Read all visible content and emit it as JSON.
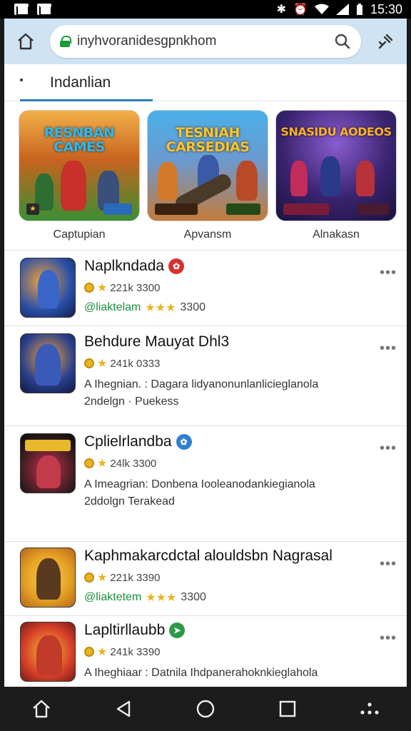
{
  "status": {
    "time": "15:30"
  },
  "browser": {
    "url": "inyhvoranidesgpnkhom"
  },
  "tabs": {
    "active": "Indanlian"
  },
  "featured": [
    {
      "art_title": "RESNBAN CAMES",
      "label": "Captupian",
      "colors": [
        "#f0a040",
        "#3c8f3c"
      ]
    },
    {
      "art_title": "TESNIAH CARSEDIAS",
      "label": "Apvansm",
      "colors": [
        "#3aa8e0",
        "#c86a2e"
      ]
    },
    {
      "art_title": "SNASIDU AODEOS",
      "label": "Alnakasn",
      "colors": [
        "#3a2c7a",
        "#a33b8c"
      ]
    }
  ],
  "apps": [
    {
      "title": "Naplkndada",
      "badge_color": "#d8312c",
      "badge_glyph": "✿",
      "rating": "221k  3300",
      "publisher": "@liaktelam",
      "stars": "★★★",
      "pub_rating": "3300",
      "thumb": [
        "#1b2f6b",
        "#e37a1e"
      ]
    },
    {
      "title": "Behdure Mauyat Dhl3",
      "rating": "241k  0333",
      "desc1": "A Ihegnian. : Dagara lidyanonunlanlicieglanola",
      "desc2": "2ndelgn · Puekess",
      "thumb": [
        "#1a2860",
        "#d8831e"
      ]
    },
    {
      "title": "Cplielrlandba",
      "badge_color": "#2f80d0",
      "badge_glyph": "✿",
      "rating": "24lk  3300",
      "desc1": "A Imeagrian: Donbena Iooleanodankiegianola",
      "desc2": "2ddolgn Terakead",
      "thumb": [
        "#111111",
        "#c73050"
      ]
    },
    {
      "title": "Kaphmakarcdctal alouldsbn Nagrasal",
      "rating": "221k  3390",
      "publisher": "@liaktetem",
      "stars": "★★★",
      "pub_rating": "3300",
      "thumb": [
        "#e6a224",
        "#5a3a1e"
      ]
    },
    {
      "title": "Lapltirllaubb",
      "badge_color": "#2e9a48",
      "badge_glyph": "➤",
      "rating": "241k  3390",
      "desc1": "A Iheghiaar : Datnila Ihdpanerahoknkieglahola",
      "thumb": [
        "#d8412a",
        "#f2c230"
      ]
    }
  ]
}
